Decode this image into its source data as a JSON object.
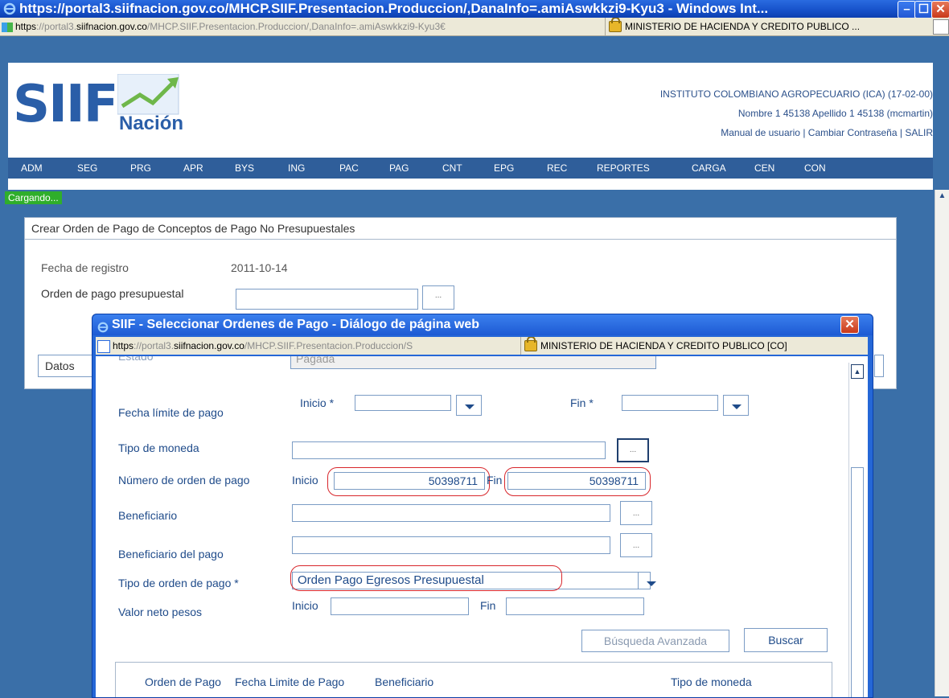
{
  "window": {
    "title": "https://portal3.siifnacion.gov.co/MHCP.SIIF.Presentacion.Produccion/,DanaInfo=.amiAswkkzi9-Kyu3 - Windows Int...",
    "address_scheme": "https",
    "address_rest": "://portal3.",
    "address_domain": "siifnacion.gov.co",
    "address_path": "/MHCP.SIIF.Presentacion.Produccion/,DanaInfo=.amiAswkkzi9-Kyu3€",
    "cert_label": "MINISTERIO DE HACIENDA Y CREDITO PUBLICO ..."
  },
  "header": {
    "logo_text": "SIIF",
    "logo_sub": "Nación",
    "institution": "INSTITUTO COLOMBIANO AGROPECUARIO (ICA) (17-02-00)",
    "user": "Nombre 1 45138 Apellido 1 45138 (mcmartin)",
    "link_manual": "Manual de usuario",
    "sep": "|",
    "link_password": "Cambiar Contraseña",
    "link_exit": "SALIR"
  },
  "nav": {
    "items": [
      "ADM",
      "SEG",
      "PRG",
      "APR",
      "BYS",
      "ING",
      "PAC",
      "PAG",
      "CNT",
      "EPG",
      "REC",
      "REPORTES",
      "CARGA",
      "CEN",
      "CON"
    ]
  },
  "status": {
    "loading": "Cargando..."
  },
  "form": {
    "title": "Crear Orden de Pago de Conceptos de Pago No Presupuestales",
    "fecha_label": "Fecha de registro",
    "fecha_value": "2011-10-14",
    "orden_label": "Orden de pago presupuestal",
    "dots": "...",
    "tab_datos": "Datos"
  },
  "dialog": {
    "title": "SIIF - Seleccionar Ordenes de Pago - Diálogo de página web",
    "address_scheme": "https",
    "address_rest": "://portal3.",
    "address_domain": "siifnacion.gov.co",
    "address_path": "/MHCP.SIIF.Presentacion.Produccion/S",
    "cert_label": "MINISTERIO DE HACIENDA Y CREDITO PUBLICO [CO]",
    "estado_label": "Estado",
    "estado_value": "Pagada",
    "fecha_limite_label": "Fecha límite de pago",
    "inicio_req": "Inicio *",
    "fin_req": "Fin *",
    "tipo_moneda_label": "Tipo de moneda",
    "numero_label": "Número de orden de pago",
    "inicio": "Inicio",
    "fin": "Fin",
    "numero_inicio": "50398711",
    "numero_fin": "50398711",
    "beneficiario_label": "Beneficiario",
    "beneficiario_pago_label": "Beneficiario del pago",
    "tipo_orden_label": "Tipo de orden de pago",
    "required": "*",
    "tipo_orden_value": "Orden Pago Egresos Presupuestal",
    "valor_neto_label": "Valor neto pesos",
    "busqueda_avanzada": "Búsqueda Avanzada",
    "buscar": "Buscar",
    "dots": "...",
    "columns": [
      "Orden de Pago",
      "Fecha Limite de Pago",
      "Beneficiario",
      "Tipo de moneda"
    ]
  },
  "colors": {
    "accent": "#2f5e9a",
    "highlight": "#d8262b",
    "loading": "#2fae2b"
  }
}
